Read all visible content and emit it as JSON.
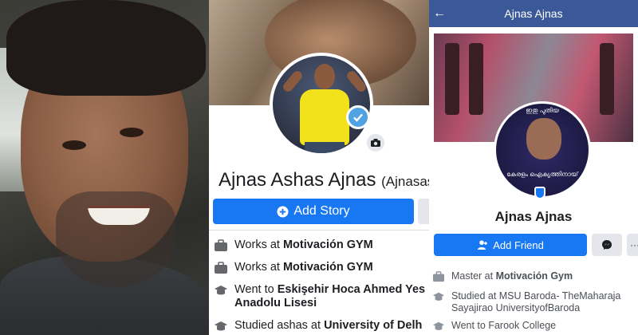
{
  "left_photo": {
    "description_icon": "selfie-photo"
  },
  "profile_a": {
    "name": "Ajnas Ashas Ajnas",
    "alternate_name": "(Ajnasash",
    "add_story_label": "Add Story",
    "info": [
      {
        "prefix": "Works at ",
        "bold": "Motivación GYM",
        "icon": "briefcase-icon"
      },
      {
        "prefix": "Works at ",
        "bold": "Motivación GYM",
        "icon": "briefcase-icon"
      },
      {
        "prefix": "Went to ",
        "bold": "Eskişehir Hoca Ahmed Yes",
        "bold2": "Anadolu Lisesi",
        "icon": "graduation-cap-icon"
      },
      {
        "prefix": "Studied ashas at ",
        "bold": "University of Delh",
        "icon": "graduation-cap-icon"
      }
    ],
    "colors": {
      "primary": "#1877f2",
      "verified": "#4fa3e3"
    }
  },
  "profile_b": {
    "header_title": "Ajnas Ajnas",
    "avatar_text_top": "ഇതു പുതിയ",
    "avatar_text_bottom": "കേരളം ഐക്യത്തിനായ്",
    "name": "Ajnas Ajnas",
    "add_friend_label": "Add Friend",
    "more_label": "···",
    "info": [
      {
        "prefix": "Master at ",
        "bold": "Motivación Gym",
        "icon": "briefcase-icon"
      },
      {
        "prefix": "Studied at ",
        "bold": "MSU Baroda- TheMaharaja",
        "line2": "Sayajirao UniversityofBaroda",
        "icon": "graduation-cap-icon"
      },
      {
        "prefix": "Went to ",
        "bold": "Farook College",
        "icon": "graduation-cap-icon"
      }
    ],
    "colors": {
      "header": "#3b5998",
      "primary": "#1877f2"
    }
  }
}
